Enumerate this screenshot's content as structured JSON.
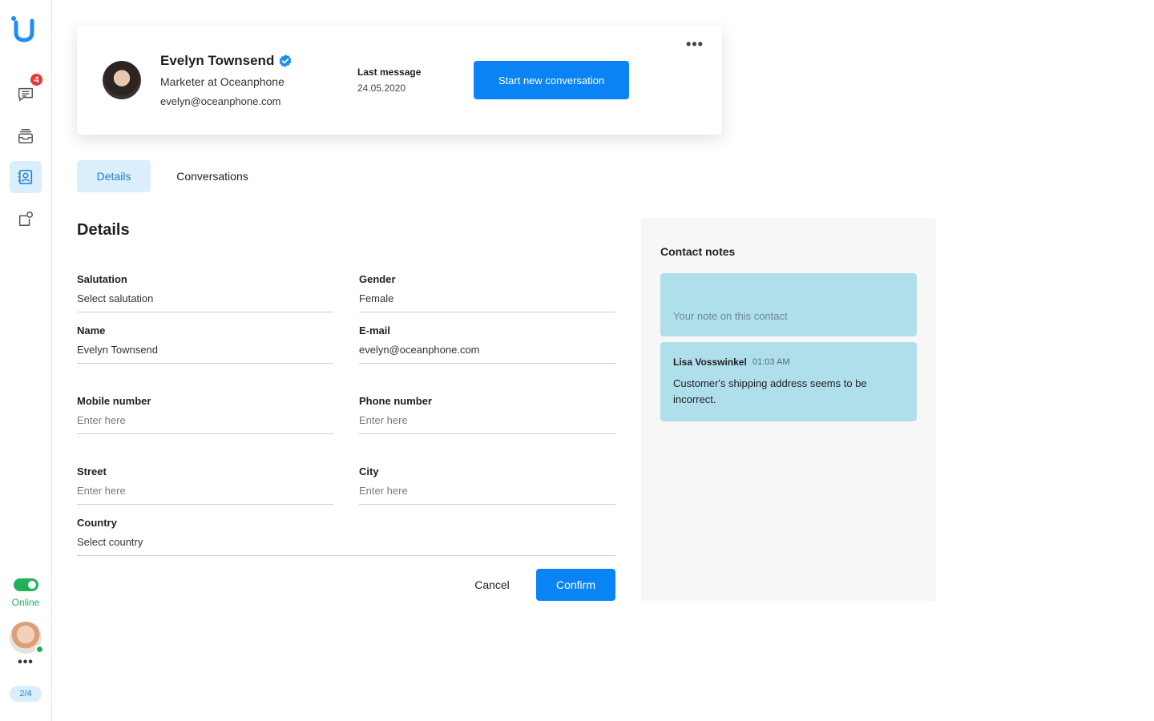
{
  "sidebar": {
    "logo": "U-logo",
    "items": [
      {
        "name": "chat-icon",
        "badge": "4"
      },
      {
        "name": "inbox-stack-icon"
      },
      {
        "name": "contacts-icon",
        "active": true
      },
      {
        "name": "integrations-icon"
      }
    ],
    "status_label": "Online",
    "status_on": true,
    "more": "•••",
    "page_indicator": "2/4"
  },
  "profile": {
    "name": "Evelyn Townsend",
    "verified": true,
    "role": "Marketer at Oceanphone",
    "email": "evelyn@oceanphone.com",
    "last_message_label": "Last message",
    "last_message_date": "24.05.2020",
    "start_button": "Start new conversation",
    "more": "•••"
  },
  "tabs": [
    {
      "label": "Details",
      "active": true
    },
    {
      "label": "Conversations",
      "active": false
    }
  ],
  "details": {
    "title": "Details",
    "fields": {
      "salutation": {
        "label": "Salutation",
        "value": "Select salutation"
      },
      "gender": {
        "label": "Gender",
        "value": "Female"
      },
      "name": {
        "label": "Name",
        "value": "Evelyn Townsend"
      },
      "email": {
        "label": "E-mail",
        "value": "evelyn@oceanphone.com"
      },
      "mobile": {
        "label": "Mobile number",
        "placeholder": "Enter here"
      },
      "phone": {
        "label": "Phone number",
        "placeholder": "Enter here"
      },
      "street": {
        "label": "Street",
        "placeholder": "Enter here"
      },
      "city": {
        "label": "City",
        "placeholder": "Enter here"
      },
      "country": {
        "label": "Country",
        "value": "Select country"
      }
    },
    "cancel": "Cancel",
    "confirm": "Confirm"
  },
  "notes": {
    "title": "Contact notes",
    "input_placeholder": "Your note on this contact",
    "items": [
      {
        "author": "Lisa Vosswinkel",
        "time": "01:03 AM",
        "text": "Customer's shipping address seems to be incorrect."
      }
    ]
  },
  "colors": {
    "accent": "#0a84f5",
    "online": "#1fb15a",
    "badge": "#e53935",
    "note_bg": "#b0dfec",
    "tab_active_bg": "#dbeefc"
  }
}
